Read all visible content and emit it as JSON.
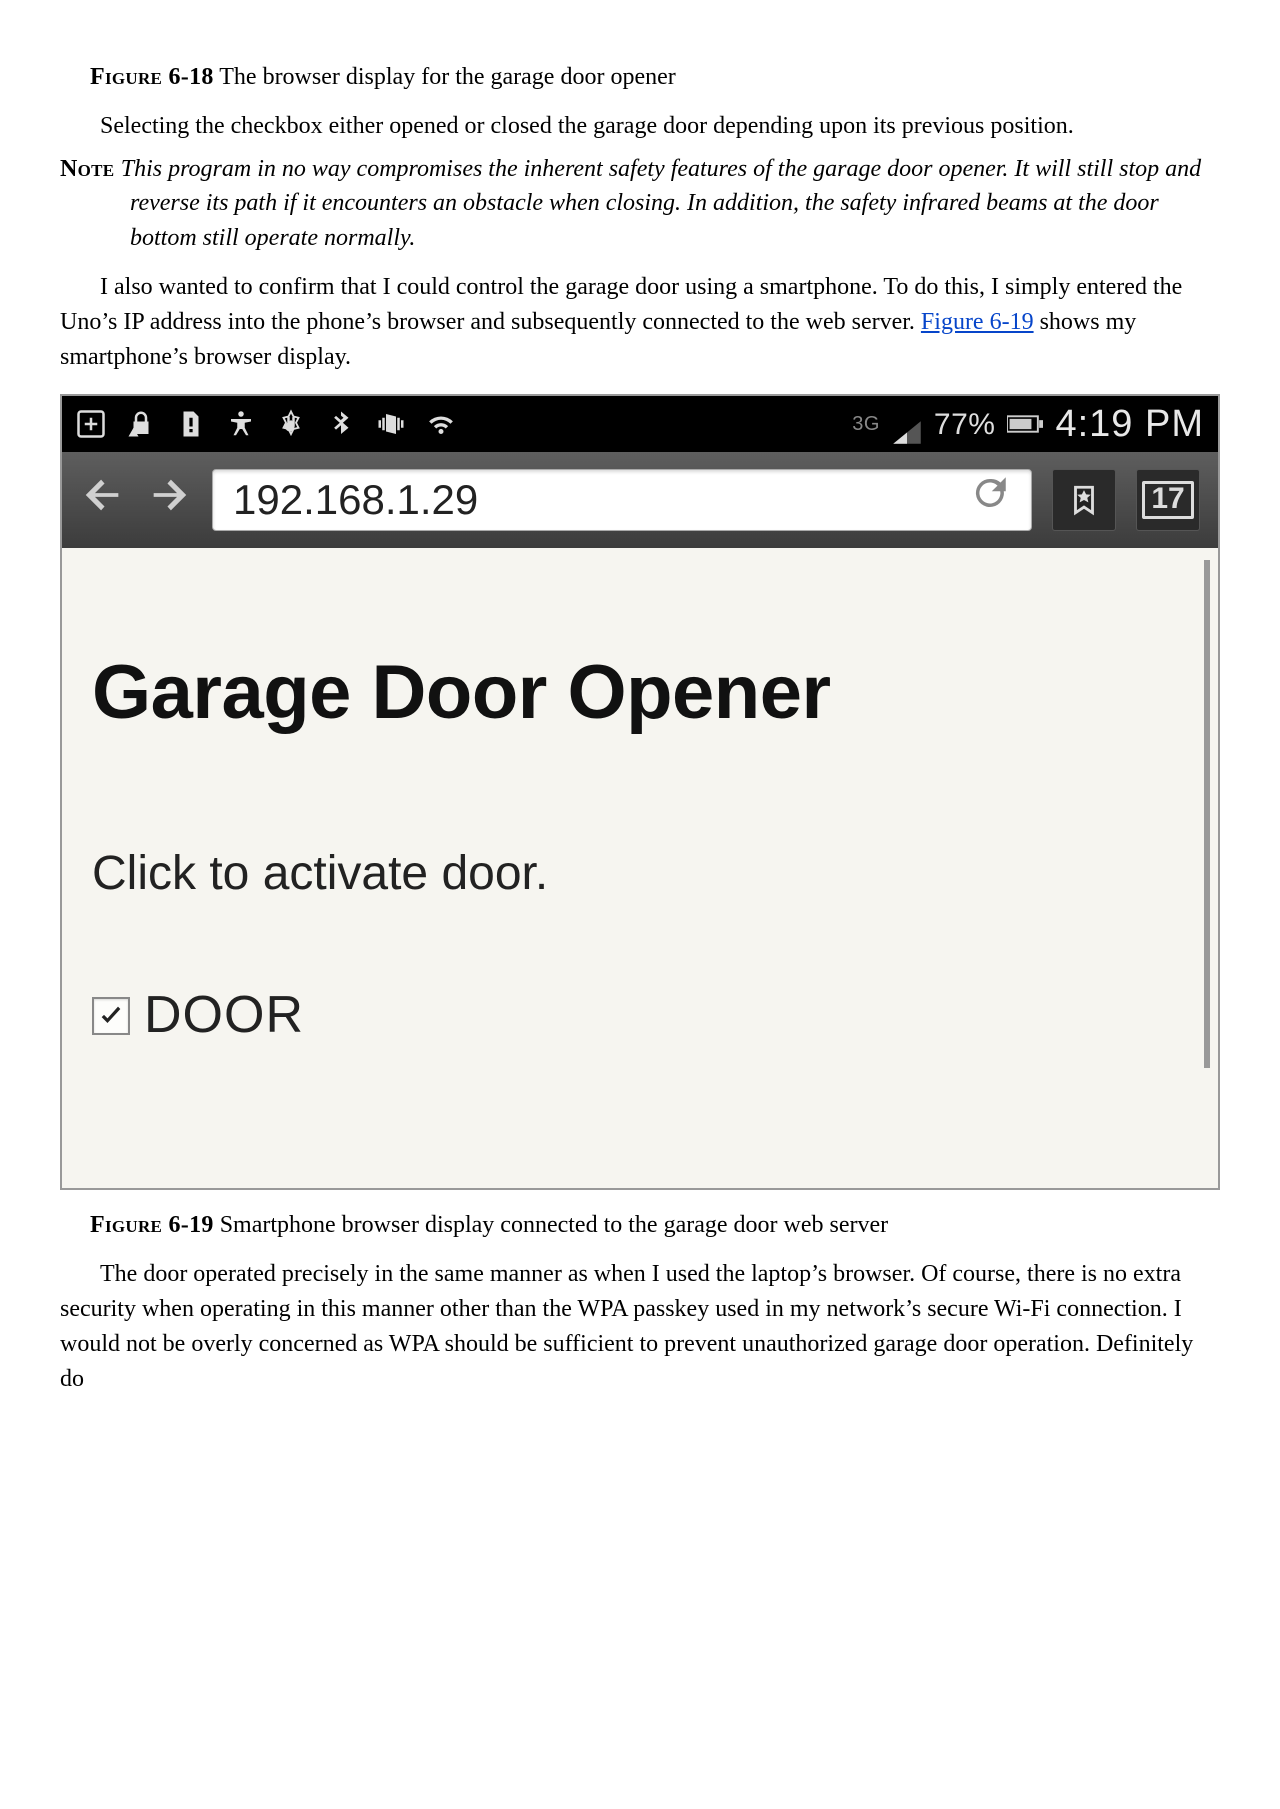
{
  "captions": {
    "fig18_label": "Figure 6-18",
    "fig18_text": " The browser display for the garage door opener",
    "fig19_label": "Figure 6-19",
    "fig19_text": " Smartphone browser display connected to the garage door web server"
  },
  "paragraphs": {
    "p1": "Selecting the checkbox either opened or closed the garage door depending upon its previous position.",
    "p2a": "I also wanted to confirm that I could control the garage door using a smartphone. To do this, I simply entered the Uno’s IP address into the phone’s browser and subsequently connected to the web server. ",
    "p2_link": "Figure 6-19",
    "p2b": " shows my smartphone’s browser display.",
    "p3": "The door operated precisely in the same manner as when I used the laptop’s browser. Of course, there is no extra security when operating in this manner other than the WPA passkey used in my network’s secure Wi-Fi connection. I would not be overly concerned as WPA should be sufficient to prevent unauthorized garage door operation. Definitely do"
  },
  "note": {
    "label": "Note ",
    "text": "This program in no way compromises the inherent safety features of the garage door opener. It will still stop and reverse its path if it encounters an obstacle when closing. In addition, the safety infrared beams at the door bottom still operate normally."
  },
  "phone": {
    "status": {
      "battery_pct": "77%",
      "network_label": "3G",
      "clock": "4:19 PM"
    },
    "nav": {
      "url": "192.168.1.29",
      "tab_count": "17"
    },
    "page": {
      "heading": "Garage Door Opener",
      "subtext": "Click to activate door.",
      "checkbox_label": "DOOR",
      "checkbox_checked": true
    }
  }
}
